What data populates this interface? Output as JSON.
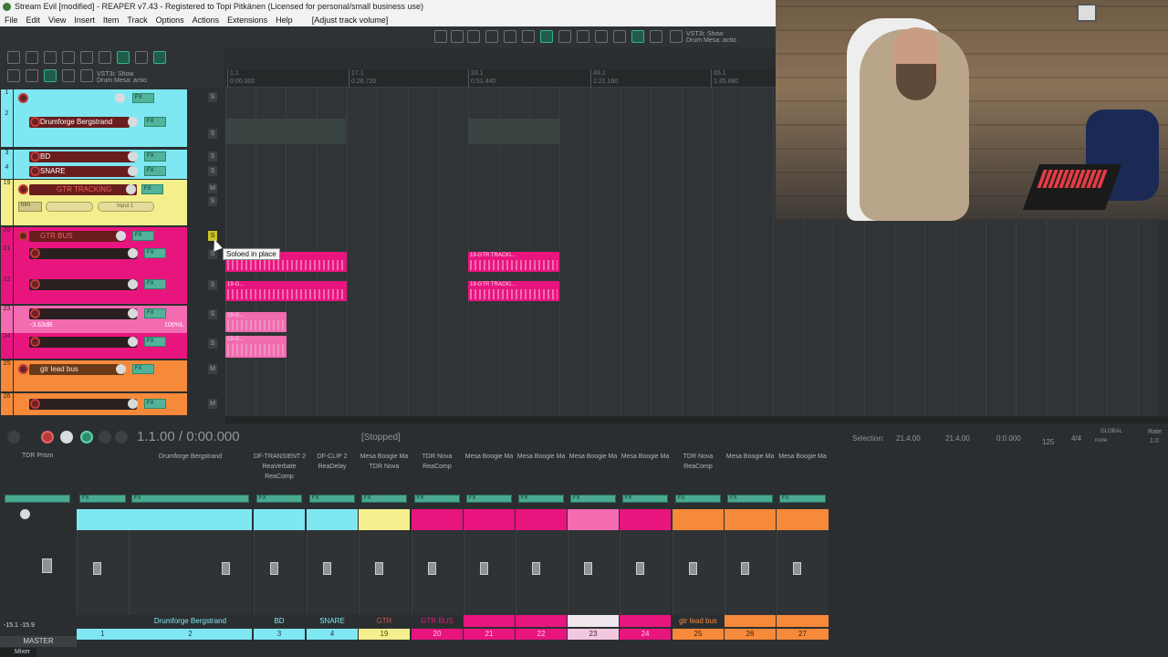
{
  "window": {
    "title": "Stream Evil [modified] - REAPER v7.43 - Registered to Topi Pitkänen (Licensed for personal/small business use)"
  },
  "menu": {
    "items": [
      "File",
      "Edit",
      "View",
      "Insert",
      "Item",
      "Track",
      "Options",
      "Actions",
      "Extensions",
      "Help"
    ],
    "hint": "[Adjust track volume]"
  },
  "toolbar": {
    "vst_text_top": "VST3i: Show\nDrum Mesa: actio",
    "vst_text_left": "VST3i: Show\nDrum Mesa: actio"
  },
  "ruler": {
    "marks": [
      "1.1",
      "17.1",
      "33.1",
      "49.1",
      "65.1"
    ],
    "times": [
      "0:00.000",
      "0:26.720",
      "0:51.440",
      "1:21.160",
      "1:45.880"
    ]
  },
  "tracks": [
    {
      "num": "1",
      "name": "",
      "color": "#7ee7f2"
    },
    {
      "num": "2",
      "name": "Drumforge Bergstrand",
      "color": "#7ee7f2"
    },
    {
      "num": "3",
      "name": "BD",
      "color": "#7ee7f2"
    },
    {
      "num": "4",
      "name": "SNARE",
      "color": "#7ee7f2"
    },
    {
      "num": "19",
      "name": "GTR TRACKING",
      "color": "#f4ef8c",
      "input": "Input 1"
    },
    {
      "num": "20",
      "name": "GTR BUS",
      "color": "#e8157f"
    },
    {
      "num": "21",
      "name": "",
      "color": "#e8157f"
    },
    {
      "num": "22",
      "name": "",
      "color": "#e8157f"
    },
    {
      "num": "23",
      "name": "",
      "color": "#f36bb1",
      "vol": "-3.63dB",
      "pan": "100%L"
    },
    {
      "num": "24",
      "name": "",
      "color": "#e8157f"
    },
    {
      "num": "25",
      "name": "gtr lead bus",
      "color": "#f7893a"
    },
    {
      "num": "26",
      "name": "",
      "color": "#f7893a"
    }
  ],
  "items_labels": {
    "gtr": "19-G...",
    "gtr_tracking": "19-GTR TRACKI..."
  },
  "tooltip": "Soloed in place",
  "transport": {
    "time": "1.1.00 / 0:00.000",
    "state": "[Stopped]",
    "selection_label": "Selection:",
    "sel_start": "21.4.00",
    "sel_end": "21.4.00",
    "sel_len": "0:0.000",
    "bpm": "125",
    "sig": "4/4",
    "global": "GLOBAL",
    "none": "none",
    "rate": "Rate:",
    "rate_val": "1.0"
  },
  "mixer": {
    "master_label": "MASTER",
    "master_plugin": "TDR Prism",
    "master_vals": "-15.1   -15.9",
    "mixer_tab": "Mixer",
    "strips": [
      {
        "plugins": "",
        "name": "",
        "num": "1",
        "color": "#7ee7f2"
      },
      {
        "plugins": "Drumforge Bergstrand",
        "name": "Drumforge Bergstrand",
        "num": "2",
        "color": "#7ee7f2"
      },
      {
        "plugins": "DF-TRANSIENT 2\nReaVerbate\nReaComp",
        "name": "BD",
        "num": "3",
        "color": "#7ee7f2"
      },
      {
        "plugins": "DF-CLIP 2\nReaDelay",
        "name": "SNARE",
        "num": "4",
        "color": "#7ee7f2"
      },
      {
        "plugins": "Mesa Boogie Ma\nTDR Nova",
        "name": "GTR TRACKING",
        "num": "19",
        "color": "#f4ef8c"
      },
      {
        "plugins": "TDR Nova\nReaComp",
        "name": "GTR BUS",
        "num": "20",
        "color": "#e8157f"
      },
      {
        "plugins": "Mesa Boogie Ma",
        "name": "",
        "num": "21",
        "color": "#e8157f"
      },
      {
        "plugins": "Mesa Boogie Ma",
        "name": "",
        "num": "22",
        "color": "#e8157f"
      },
      {
        "plugins": "Mesa Boogie Ma",
        "name": "",
        "num": "23",
        "color": "#f36bb1"
      },
      {
        "plugins": "Mesa Boogie Ma",
        "name": "",
        "num": "24",
        "color": "#e8157f"
      },
      {
        "plugins": "TDR Nova\nReaComp",
        "name": "gtr lead bus",
        "num": "25",
        "color": "#f7893a"
      },
      {
        "plugins": "Mesa Boogie Ma",
        "name": "",
        "num": "26",
        "color": "#f7893a"
      },
      {
        "plugins": "Mesa Boogie Ma",
        "name": "",
        "num": "27",
        "color": "#f7893a"
      }
    ]
  },
  "colors": {
    "cyan": "#7ee7f2",
    "yellow": "#f4ef8c",
    "magenta": "#e8157f",
    "pink": "#f36bb1",
    "orange": "#f7893a",
    "fx_green": "#4ba891"
  }
}
